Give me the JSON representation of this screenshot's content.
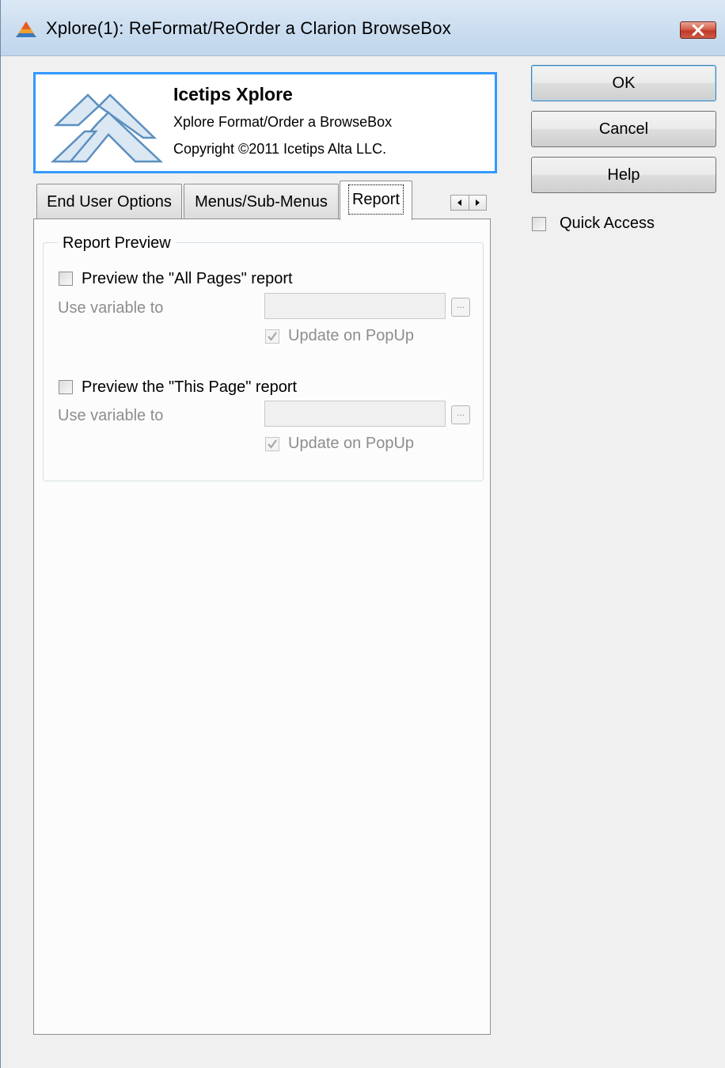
{
  "window": {
    "title": "Xplore(1): ReFormat/ReOrder a Clarion BrowseBox"
  },
  "header": {
    "product_name": "Icetips Xplore",
    "subtitle": "Xplore Format/Order a BrowseBox",
    "copyright": "Copyright ©2011 Icetips Alta LLC."
  },
  "tabs": [
    {
      "label": "End User Options",
      "active": false
    },
    {
      "label": "Menus/Sub-Menus",
      "active": false
    },
    {
      "label": "Report",
      "active": true
    }
  ],
  "report_preview": {
    "group_label": "Report Preview",
    "all_pages": {
      "checkbox_label": "Preview the \"All Pages\" report",
      "checked": false,
      "variable_label": "Use variable to",
      "variable_value": "",
      "ellipsis_label": "...",
      "update_label": "Update on PopUp",
      "update_checked": true
    },
    "this_page": {
      "checkbox_label": "Preview the \"This Page\" report",
      "checked": false,
      "variable_label": "Use variable to",
      "variable_value": "",
      "ellipsis_label": "...",
      "update_label": "Update on PopUp",
      "update_checked": true
    }
  },
  "buttons": {
    "ok": "OK",
    "cancel": "Cancel",
    "help": "Help"
  },
  "quick_access": {
    "label": "Quick Access",
    "checked": false
  },
  "colors": {
    "header_border": "#3399ff",
    "close_button": "#c0392b",
    "logo_blue": "#5b8fbf"
  },
  "icons": [
    "app-icon",
    "close-icon",
    "icetips-logo",
    "arrow-left-icon",
    "arrow-right-icon",
    "checkmark-icon"
  ]
}
